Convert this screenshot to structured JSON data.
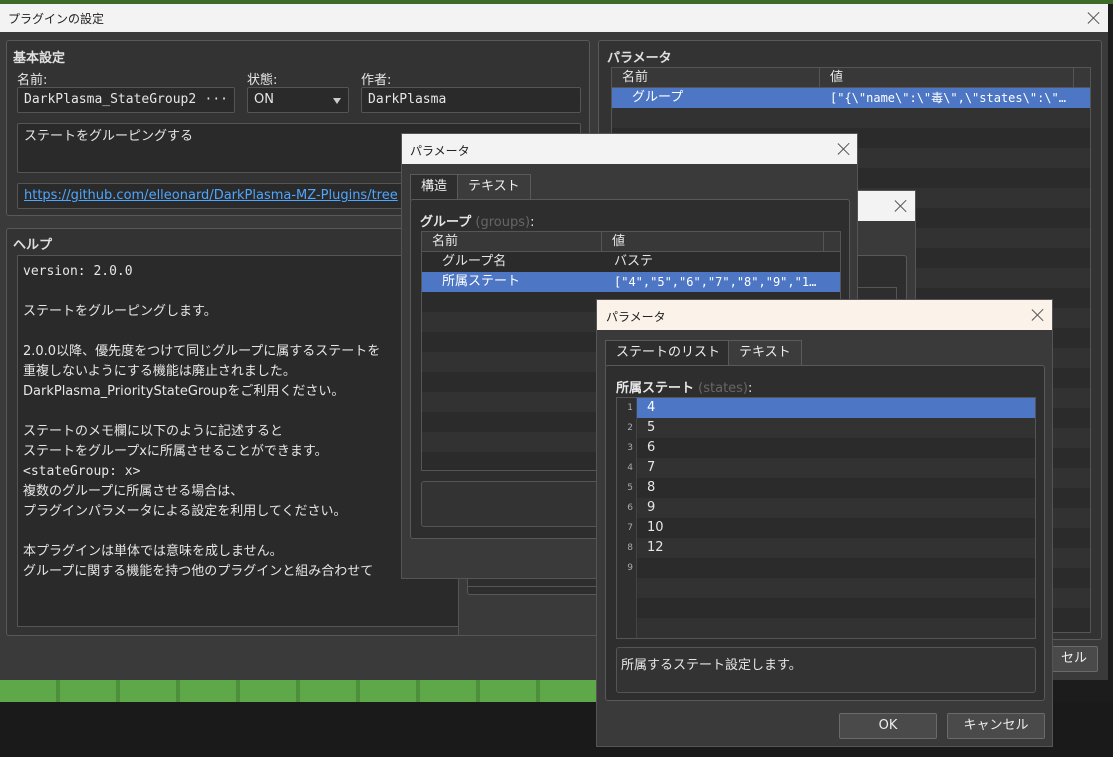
{
  "main_window": {
    "title": "プラグインの設定",
    "basic": {
      "heading": "基本設定",
      "name_label": "名前:",
      "name_value": "DarkPlasma_StateGroup2",
      "name_more": "···",
      "status_label": "状態:",
      "status_value": "ON",
      "author_label": "作者:",
      "author_value": "DarkPlasma",
      "description": "ステートをグルーピングする",
      "url": "https://github.com/elleonard/DarkPlasma-MZ-Plugins/tree"
    },
    "help": {
      "heading": "ヘルプ",
      "lines": [
        "version: 2.0.0",
        "",
        "ステートをグルーピングします。",
        "",
        "2.0.0以降、優先度をつけて同じグループに属するステートを",
        "重複しないようにする機能は廃止されました。",
        "DarkPlasma_PriorityStateGroupをご利用ください。",
        "",
        "ステートのメモ欄に以下のように記述すると",
        "ステートをグループxに所属させることができます。",
        "<stateGroup: x>",
        "複数のグループに所属させる場合は、",
        "プラグインパラメータによる設定を利用してください。",
        "",
        "本プラグインは単体では意味を成しません。",
        "グループに関する機能を持つ他のプラグインと組み合わせて"
      ]
    },
    "params": {
      "heading": "パラメータ",
      "col_name": "名前",
      "col_value": "値",
      "row_name": "グループ",
      "row_value": "[\"{\\\"name\\\":\\\"毒\\\",\\\"states\\\":\\\"…"
    },
    "cancel_partial": "セル"
  },
  "dialog1": {
    "title": "パラメータ",
    "tab_struct": "構造",
    "tab_text": "テキスト",
    "group_label": "グループ",
    "group_key": "(groups)",
    "group_colon": ":",
    "col_name": "名前",
    "col_value": "値",
    "rows": [
      {
        "name": "グループ名",
        "value": "バステ"
      },
      {
        "name": "所属ステート",
        "value": "[\"4\",\"5\",\"6\",\"7\",\"8\",\"9\",\"1…"
      }
    ]
  },
  "dialog3": {
    "title": "パラメータ",
    "tab_list": "ステートのリスト",
    "tab_text": "テキスト",
    "list_label": "所属ステート",
    "list_key": "(states)",
    "list_colon": ":",
    "line_numbers": [
      "1",
      "2",
      "3",
      "4",
      "5",
      "6",
      "7",
      "8",
      "9"
    ],
    "values": [
      "4",
      "5",
      "6",
      "7",
      "8",
      "9",
      "10",
      "12",
      ""
    ],
    "description": "所属するステート設定します。",
    "ok": "OK",
    "cancel": "キャンセル"
  }
}
